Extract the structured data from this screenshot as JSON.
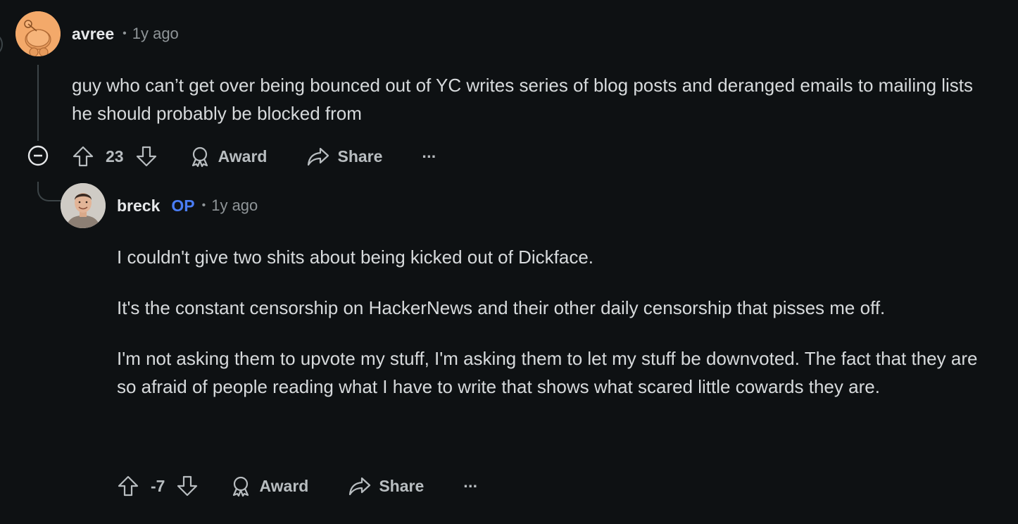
{
  "comments": [
    {
      "author": "avree",
      "separator": "•",
      "time": "1y ago",
      "paragraphs": [
        "guy who can’t get over being bounced out of YC writes series of blog posts and deranged emails to mailing lists he should probably be blocked from"
      ],
      "score": "23",
      "award_label": "Award",
      "share_label": "Share",
      "more_label": "···"
    },
    {
      "author": "breck",
      "badge": "OP",
      "separator": "•",
      "time": "1y ago",
      "paragraphs": [
        "I couldn't give two shits about being kicked out of Dickface.",
        "It's the constant censorship on HackerNews and their other daily censorship that pisses me off.",
        "I'm not asking them to upvote my stuff, I'm asking them to let my stuff be downvoted. The fact that they are so afraid of people reading what I have to write that shows what scared little cowards they are."
      ],
      "score": "-7",
      "award_label": "Award",
      "share_label": "Share",
      "more_label": "···"
    }
  ],
  "icons": {
    "upvote": "arrow-up-outline-icon",
    "downvote": "arrow-down-outline-icon",
    "award": "award-ribbon-icon",
    "share": "share-arrow-icon",
    "collapse": "minus-circle-icon"
  },
  "colors": {
    "background": "#0e1113",
    "op_badge": "#4a7df5",
    "avatar_snoo": "#f3a96a"
  }
}
